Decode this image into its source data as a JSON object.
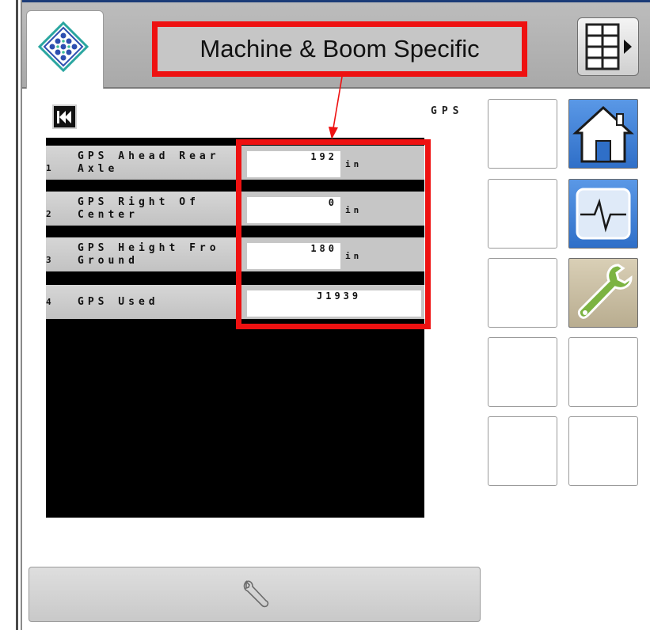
{
  "header": {
    "title": "Machine & Boom Specific"
  },
  "section": {
    "label": "GPS"
  },
  "rows": [
    {
      "num": "1",
      "label_line1": "GPS Ahead Rear",
      "label_line2": "Axle",
      "value": "192",
      "unit": "in"
    },
    {
      "num": "2",
      "label_line1": "GPS Right Of",
      "label_line2": "Center",
      "value": "0",
      "unit": "in"
    },
    {
      "num": "3",
      "label_line1": "GPS Height Fro",
      "label_line2": "Ground",
      "value": "180",
      "unit": "in"
    },
    {
      "num": "4",
      "label_line1": "GPS Used",
      "label_line2": "",
      "value": "J1939",
      "unit": ""
    }
  ],
  "side_buttons": {
    "home": "home-icon",
    "diagnostics": "heartbeat-icon",
    "tools": "wrench-icon"
  },
  "colors": {
    "highlight": "#ee1111",
    "button_blue": "#3a7ed6",
    "button_green": "#7cb342"
  }
}
